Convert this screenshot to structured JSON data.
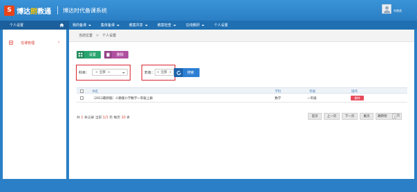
{
  "header": {
    "logo_mark": "S",
    "logo_text_a": "博达",
    "logo_text_b": "朗",
    "logo_text_c": "教通",
    "system_title": "博达时代备课系统",
    "username": "刘艳虎"
  },
  "navbar": {
    "side_title": "个人设置",
    "items": [
      {
        "label": "我的备课",
        "dropdown": true
      },
      {
        "label": "集体备课",
        "dropdown": true
      },
      {
        "label": "教案共享",
        "dropdown": true
      },
      {
        "label": "教案检查",
        "dropdown": true
      },
      {
        "label": "在线教研",
        "dropdown": true
      },
      {
        "label": "个人设置",
        "dropdown": false
      }
    ]
  },
  "sidebar": {
    "items": [
      {
        "label": "任课管理",
        "icon": "book-icon",
        "active": true
      }
    ]
  },
  "breadcrumb": {
    "current_label": "当前位置",
    "page": "个人设置"
  },
  "toolbar": {
    "settings_label": "设置",
    "delete_label": "删除"
  },
  "filters": {
    "subject_label": "科目：",
    "subject_value": "全部",
    "grade_label": "年级：",
    "grade_value": "全部",
    "search_label": "搜索"
  },
  "table": {
    "headers": {
      "book": "书名",
      "subject": "学科",
      "grade": "年级",
      "action": "操作"
    },
    "rows": [
      {
        "book": "（2012最新版）人教版小学数学一年级上册",
        "subject": "数学",
        "grade": "一年级",
        "action": "删除"
      }
    ]
  },
  "pager": {
    "summary_prefix": "共",
    "total": "1",
    "summary_mid1": "条记录 当前",
    "current": "1",
    "slash": "/",
    "pages": "1",
    "summary_mid2": "页 每页",
    "per_page": "10",
    "summary_suffix": "条",
    "first": "首页",
    "prev": "上一页",
    "next": "下一页",
    "last": "尾页",
    "jump_label": "跳转到",
    "jump_value": "1",
    "jump_suffix": "页"
  },
  "colors": {
    "header_blue": "#2b7fc4",
    "nav_blue": "#1f6fb2",
    "settings_green": "#2aa56f",
    "delete_purple": "#b04fa0",
    "search_blue": "#2d7fd3",
    "highlight_red": "#d8242a"
  }
}
